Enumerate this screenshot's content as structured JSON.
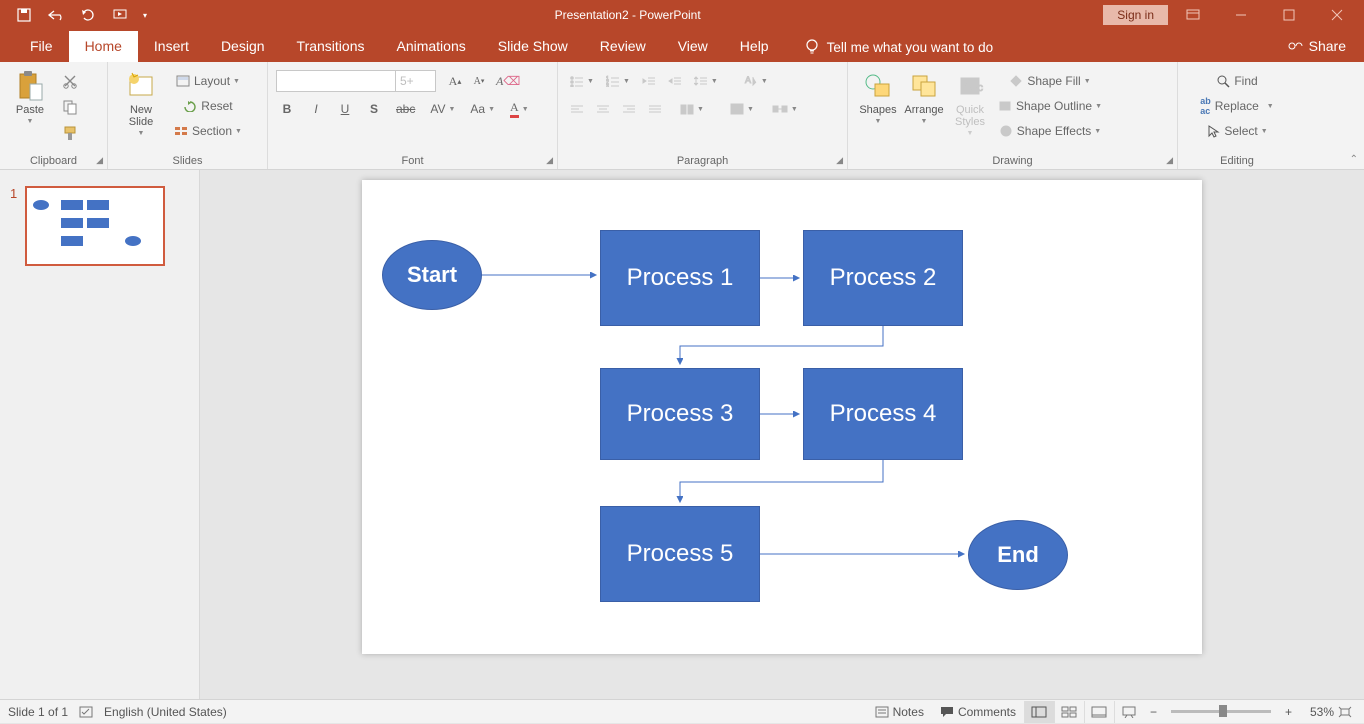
{
  "app": {
    "title": "Presentation2  -  PowerPoint",
    "signin": "Sign in",
    "share": "Share"
  },
  "tabs": {
    "file": "File",
    "home": "Home",
    "insert": "Insert",
    "design": "Design",
    "transitions": "Transitions",
    "animations": "Animations",
    "slideshow": "Slide Show",
    "review": "Review",
    "view": "View",
    "help": "Help",
    "tellme": "Tell me what you want to do"
  },
  "ribbon": {
    "clipboard": {
      "label": "Clipboard",
      "paste": "Paste"
    },
    "slides": {
      "label": "Slides",
      "newslide": "New\nSlide",
      "layout": "Layout",
      "reset": "Reset",
      "section": "Section"
    },
    "font": {
      "label": "Font",
      "size_ph": "5+"
    },
    "paragraph": {
      "label": "Paragraph"
    },
    "drawing": {
      "label": "Drawing",
      "shapes": "Shapes",
      "arrange": "Arrange",
      "quick": "Quick\nStyles",
      "fill": "Shape Fill",
      "outline": "Shape Outline",
      "effects": "Shape Effects"
    },
    "editing": {
      "label": "Editing",
      "find": "Find",
      "replace": "Replace",
      "select": "Select"
    }
  },
  "thumb": {
    "num": "1"
  },
  "flow": {
    "start": "Start",
    "p1": "Process 1",
    "p2": "Process 2",
    "p3": "Process 3",
    "p4": "Process 4",
    "p5": "Process 5",
    "end": "End"
  },
  "status": {
    "slide": "Slide 1 of 1",
    "lang": "English (United States)",
    "notes": "Notes",
    "comments": "Comments",
    "zoom": "53%"
  },
  "chart_data": {
    "type": "flowchart",
    "nodes": [
      {
        "id": "start",
        "label": "Start",
        "shape": "ellipse"
      },
      {
        "id": "p1",
        "label": "Process 1",
        "shape": "rect"
      },
      {
        "id": "p2",
        "label": "Process 2",
        "shape": "rect"
      },
      {
        "id": "p3",
        "label": "Process 3",
        "shape": "rect"
      },
      {
        "id": "p4",
        "label": "Process 4",
        "shape": "rect"
      },
      {
        "id": "p5",
        "label": "Process 5",
        "shape": "rect"
      },
      {
        "id": "end",
        "label": "End",
        "shape": "ellipse"
      }
    ],
    "edges": [
      [
        "start",
        "p1"
      ],
      [
        "p1",
        "p2"
      ],
      [
        "p2",
        "p3"
      ],
      [
        "p3",
        "p4"
      ],
      [
        "p4",
        "p5"
      ],
      [
        "p5",
        "end"
      ]
    ]
  }
}
